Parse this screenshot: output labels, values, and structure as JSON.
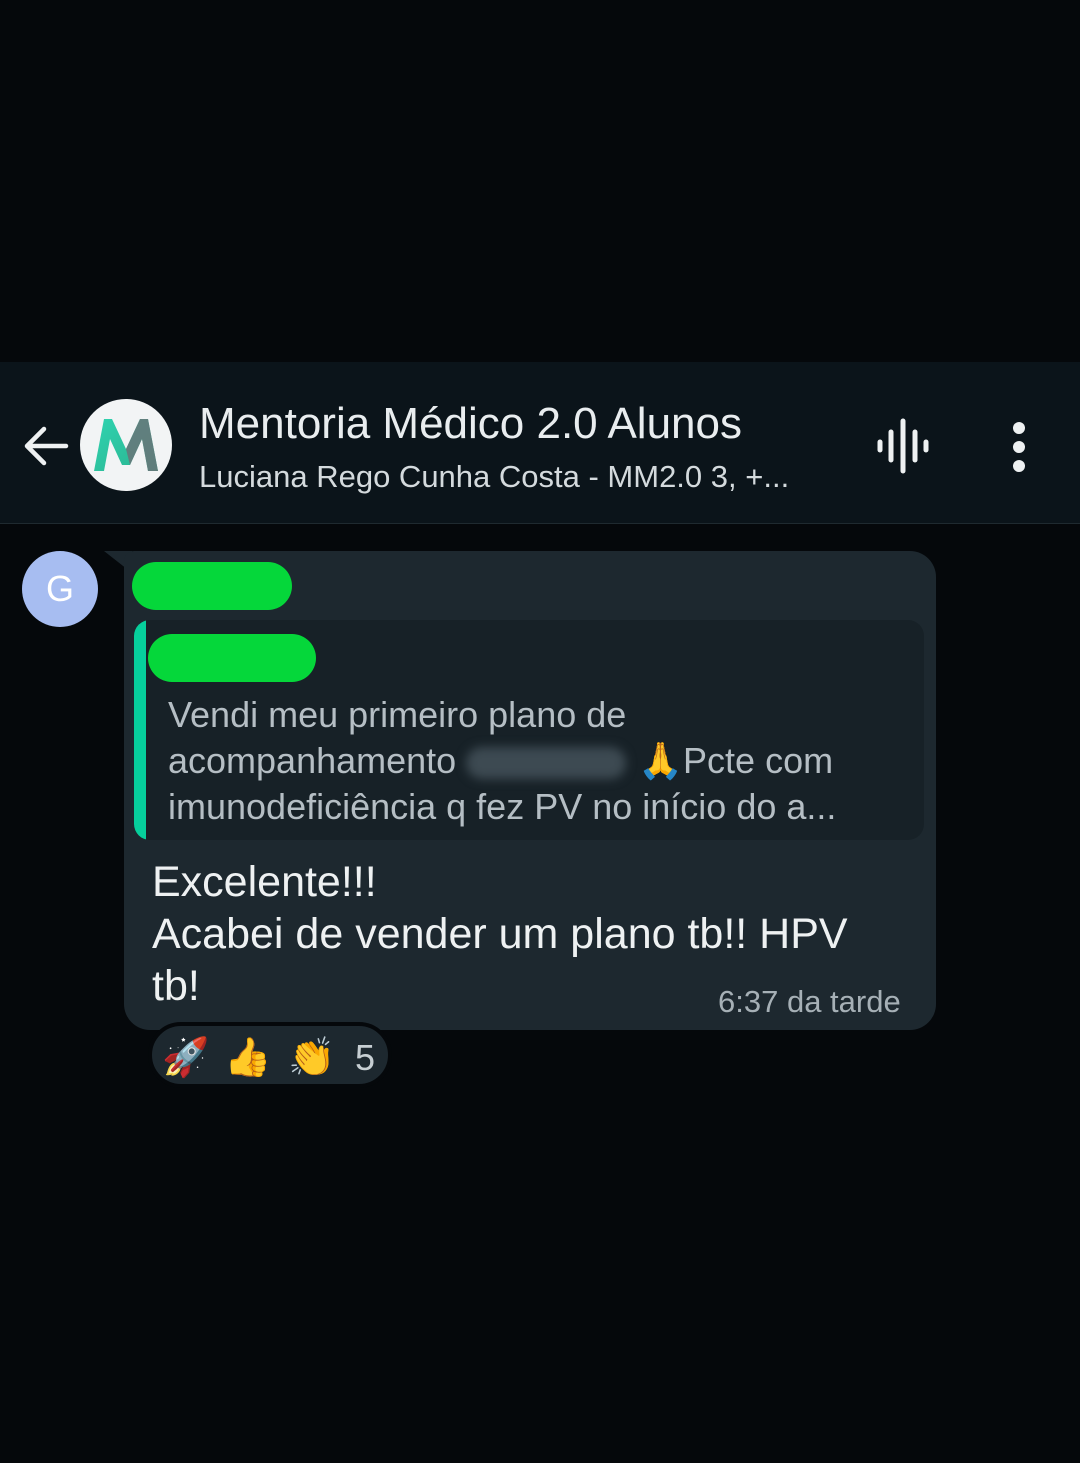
{
  "header": {
    "title": "Mentoria Médico 2.0 Alunos",
    "subtitle": "Luciana Rego Cunha Costa - MM2.0 3, +...",
    "avatar_letter": "M",
    "back_icon": "arrow-left-icon",
    "voice_icon": "voice-waveform-icon",
    "menu_icon": "more-vertical-icon"
  },
  "message": {
    "sender_initial": "G",
    "quote": {
      "line1": "Vendi meu primeiro plano de",
      "line2_prefix": "acompanhamento",
      "line2_suffix": "🙏Pcte com",
      "line3": "imunodeficiência q fez PV no início do a..."
    },
    "text_lines": [
      "Excelente!!!",
      "Acabei de vender um plano tb!! HPV",
      "tb!"
    ],
    "time": "6:37 da tarde",
    "reactions": {
      "emojis": [
        "🚀",
        "👍",
        "👏"
      ],
      "count": "5"
    }
  },
  "colors": {
    "background": "#05080b",
    "header": "#0b141a",
    "bubble": "#1d282f",
    "quote_bar": "#06cf9c",
    "redaction": "#05d73a"
  }
}
